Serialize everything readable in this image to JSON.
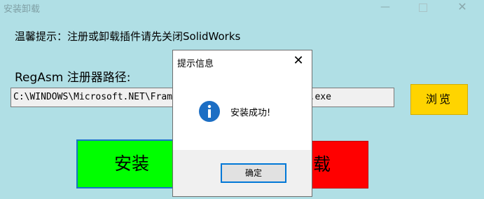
{
  "window": {
    "title": "安装卸载",
    "minimize_glyph": "—",
    "close_glyph": "✕"
  },
  "main": {
    "hint": "温馨提示：注册或卸载插件请先关闭SolidWorks",
    "path_label": "RegAsm 注册器路径:",
    "path_value": "C:\\WINDOWS\\Microsoft.NET\\Framework64\\v4.0.30319\\RegAsm.exe",
    "browse_label": "浏览",
    "install_label": "安装",
    "uninstall_label": "卸载"
  },
  "dialog": {
    "title": "提示信息",
    "close_glyph": "✕",
    "message": "安装成功!",
    "ok_label": "确定",
    "icon": "info-icon"
  },
  "colors": {
    "background": "#b0dfe5",
    "browse": "#ffd400",
    "install": "#00ff00",
    "uninstall": "#ff0000",
    "info_icon": "#1c6ec4"
  }
}
